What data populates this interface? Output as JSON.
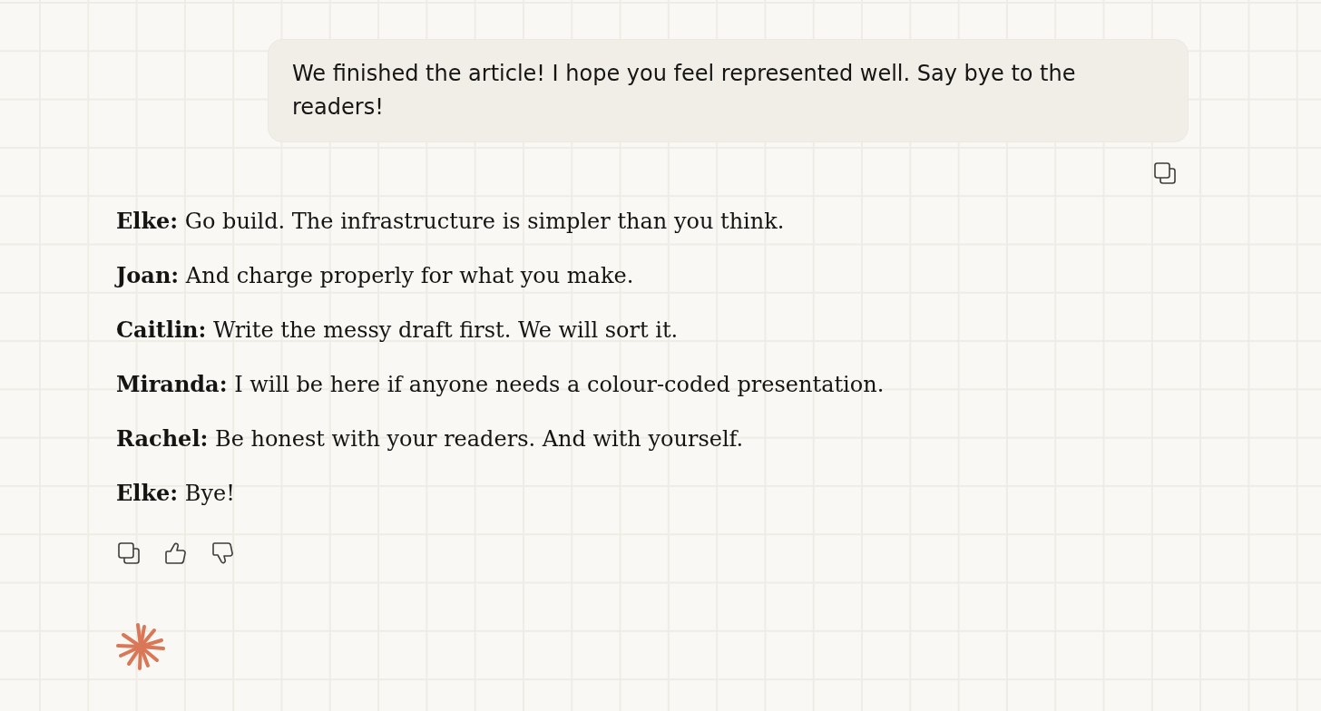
{
  "user_message": {
    "text": "We finished the article! I hope you feel represented well. Say bye to the readers!"
  },
  "reply": {
    "lines": [
      "**Elke:** Go build. The infrastructure is simpler than you think.",
      "**Joan:** And charge properly for what you make.",
      "**Caitlin:** Write the messy draft first. We will sort it.",
      "**Miranda:** I will be here if anyone needs a colour-coded presentation.",
      "**Rachel:** Be honest with your readers. And with yourself.",
      "**Elke:** Bye!"
    ]
  }
}
